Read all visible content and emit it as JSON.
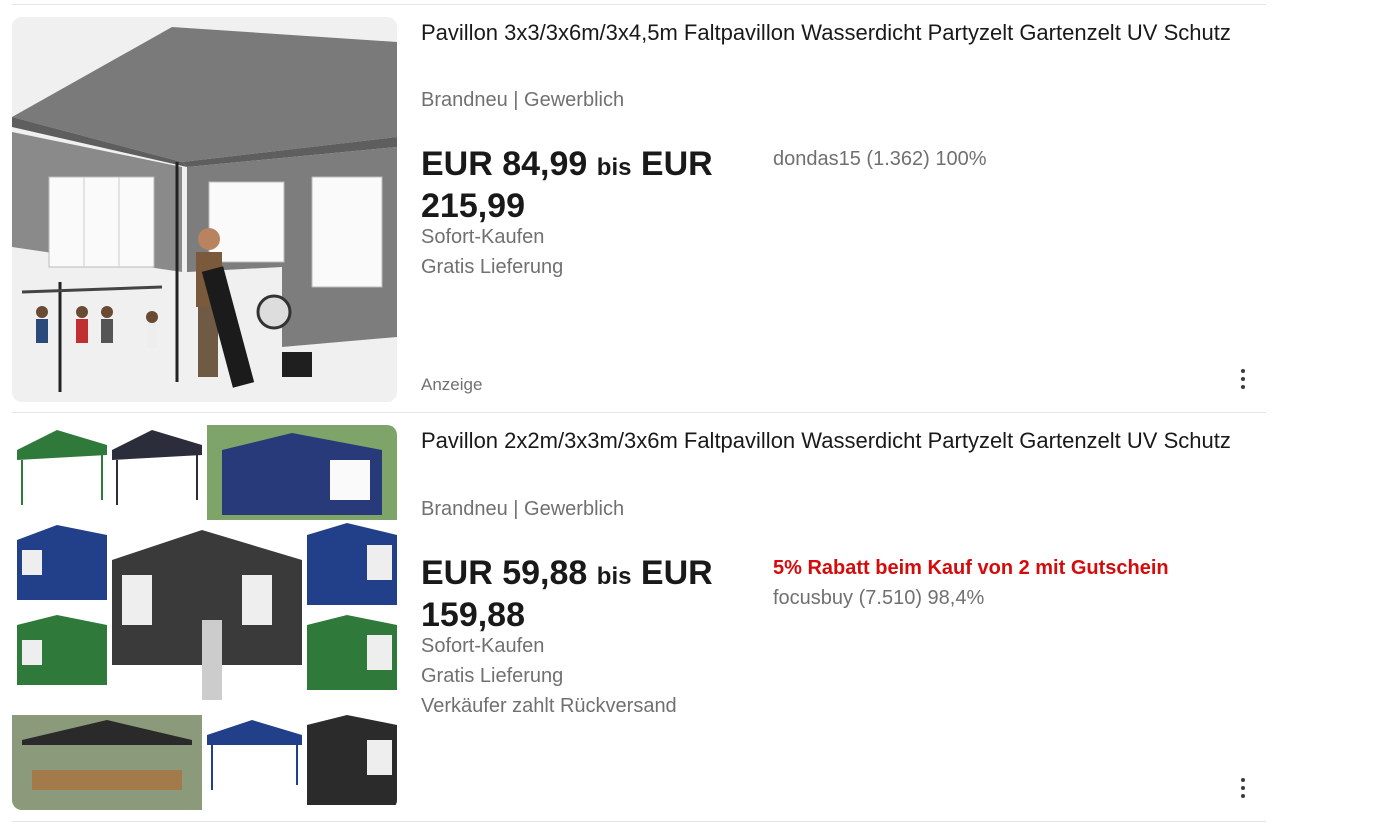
{
  "listings": [
    {
      "title": "Pavillon 3x3/3x6m/3x4,5m Faltpavillon Wasserdicht Partyzelt Gartenzelt UV Schutz",
      "subtitle": "Brandneu | Gewerblich",
      "price_from": "EUR 84,99",
      "price_sep": "bis",
      "price_to": "EUR 215,99",
      "buy_format": "Sofort-Kaufen",
      "shipping": "Gratis Lieferung",
      "seller": "dondas15 (1.362) 100%",
      "sponsored_label": "Anzeige",
      "more_icon": "more-vertical-icon"
    },
    {
      "title": "Pavillon 2x2m/3x3m/3x6m Faltpavillon Wasserdicht Partyzelt Gartenzelt UV Schutz",
      "subtitle": "Brandneu | Gewerblich",
      "price_from": "EUR 59,88",
      "price_sep": "bis",
      "price_to": "EUR 159,88",
      "buy_format": "Sofort-Kaufen",
      "shipping": "Gratis Lieferung",
      "returns": "Verkäufer zahlt Rückversand",
      "promo": "5% Rabatt beim Kauf von 2 mit Gutschein",
      "seller": "focusbuy (7.510) 98,4%",
      "more_icon": "more-vertical-icon"
    }
  ],
  "colors": {
    "promo_red": "#d50b0b",
    "muted_text": "#707070",
    "primary_text": "#191919"
  }
}
